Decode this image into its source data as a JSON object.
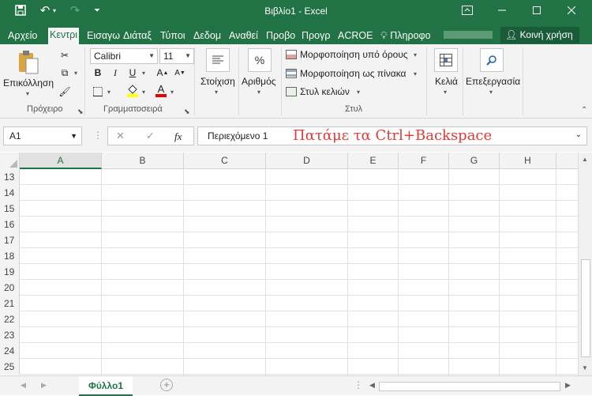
{
  "window": {
    "title": "Βιβλίο1 - Excel",
    "qat": {
      "save_icon": "save-icon",
      "undo_icon": "undo-icon",
      "redo_icon": "redo-icon",
      "customize_icon": "customize-qat-icon"
    },
    "controls": {
      "minimize": "minimize-icon",
      "restore": "ribbon-display-icon",
      "maximize": "maximize-icon",
      "close": "close-icon"
    }
  },
  "tabs": [
    {
      "label": "Αρχείο"
    },
    {
      "label": "Κεντρι",
      "active": true
    },
    {
      "label": "Εισαγω"
    },
    {
      "label": "Διάταξ"
    },
    {
      "label": "Τύποι"
    },
    {
      "label": "Δεδομ"
    },
    {
      "label": "Αναθεί"
    },
    {
      "label": "Προβο"
    },
    {
      "label": "Προγρ"
    },
    {
      "label": "ACROE"
    }
  ],
  "tell_me": "Πληροφο",
  "share": "Κοινή χρήση",
  "ribbon": {
    "clipboard": {
      "paste": "Επικόλληση",
      "group": "Πρόχειρο"
    },
    "font": {
      "name": "Calibri",
      "size": "11",
      "group": "Γραμματοσειρά",
      "bold": "B",
      "italic": "I",
      "underline": "U",
      "font_color": "A"
    },
    "alignment": {
      "label": "Στοίχιση"
    },
    "number": {
      "label": "Αριθμός",
      "symbol": "%"
    },
    "styles": {
      "conditional": "Μορφοποίηση υπό όρους",
      "as_table": "Μορφοποίηση ως πίνακα",
      "cell_styles": "Στυλ κελιών",
      "group": "Στυλ"
    },
    "cells": {
      "label": "Κελιά"
    },
    "editing": {
      "label": "Επεξεργασία"
    }
  },
  "formula_bar": {
    "name_box": "A1",
    "cancel": "✕",
    "enter": "✓",
    "fx": "fx",
    "content": "Περιεχόμενο 1",
    "annotation": "Πατάμε τα Ctrl+Backspace"
  },
  "grid": {
    "columns": [
      "A",
      "B",
      "C",
      "D",
      "E",
      "F",
      "G",
      "H"
    ],
    "rows": [
      "13",
      "14",
      "15",
      "16",
      "17",
      "18",
      "19",
      "20",
      "21",
      "22",
      "23",
      "24",
      "25"
    ]
  },
  "sheet": {
    "tab": "Φύλλο1",
    "add": "+"
  }
}
